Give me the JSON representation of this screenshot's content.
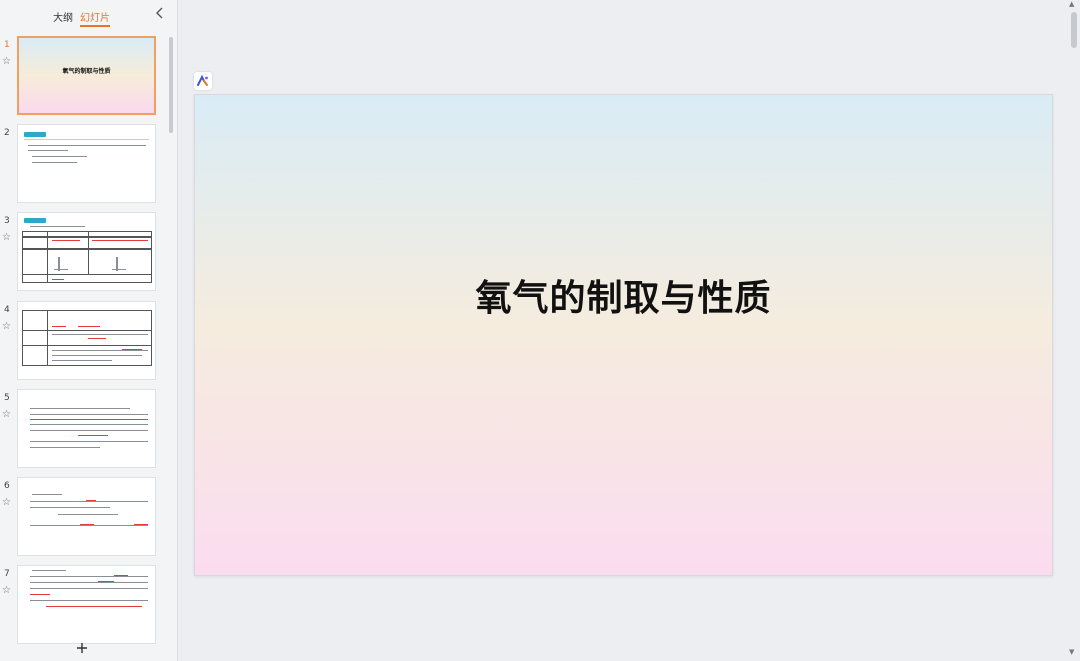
{
  "sidebar": {
    "tabs": [
      {
        "label": "大纲"
      },
      {
        "label": "幻灯片"
      }
    ],
    "collapse_icon": "chevron-left-icon",
    "add_icon": "plus-icon",
    "slides": [
      {
        "number": "1",
        "title": "氧气的制取与性质"
      },
      {
        "number": "2"
      },
      {
        "number": "3"
      },
      {
        "number": "4"
      },
      {
        "number": "5"
      },
      {
        "number": "6"
      },
      {
        "number": "7"
      }
    ]
  },
  "slide": {
    "title": "氧气的制取与性质"
  }
}
